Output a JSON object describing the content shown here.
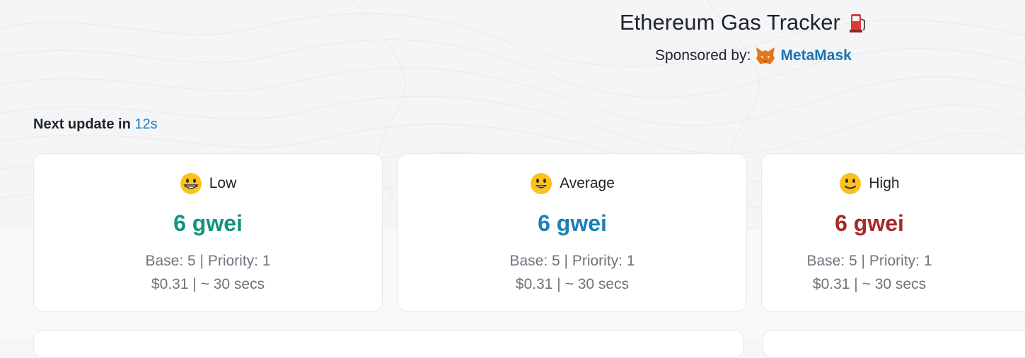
{
  "header": {
    "title": "Ethereum Gas Tracker",
    "title_icon": "fuel-pump-icon",
    "sponsor_label": "Sponsored by:",
    "sponsor_icon": "metamask-fox-icon",
    "sponsor_name": "MetaMask"
  },
  "update": {
    "label": "Next update in",
    "countdown": "12s"
  },
  "cards": [
    {
      "emoji": "grinning-face-icon",
      "label": "Low",
      "price": "6 gwei",
      "price_color": "#14937c",
      "base_priority": "Base: 5 | Priority: 1",
      "cost_time": "$0.31 | ~ 30 secs"
    },
    {
      "emoji": "smiling-face-icon",
      "label": "Average",
      "price": "6 gwei",
      "price_color": "#1c7fb8",
      "base_priority": "Base: 5 | Priority: 1",
      "cost_time": "$0.31 | ~ 30 secs"
    },
    {
      "emoji": "slightly-smiling-face-icon",
      "label": "High",
      "price": "6 gwei",
      "price_color": "#a52a2a",
      "base_priority": "Base: 5 | Priority: 1",
      "cost_time": "$0.31 | ~ 30 secs"
    }
  ],
  "colors": {
    "link": "#1c74b2",
    "muted_text": "#6c757d"
  }
}
